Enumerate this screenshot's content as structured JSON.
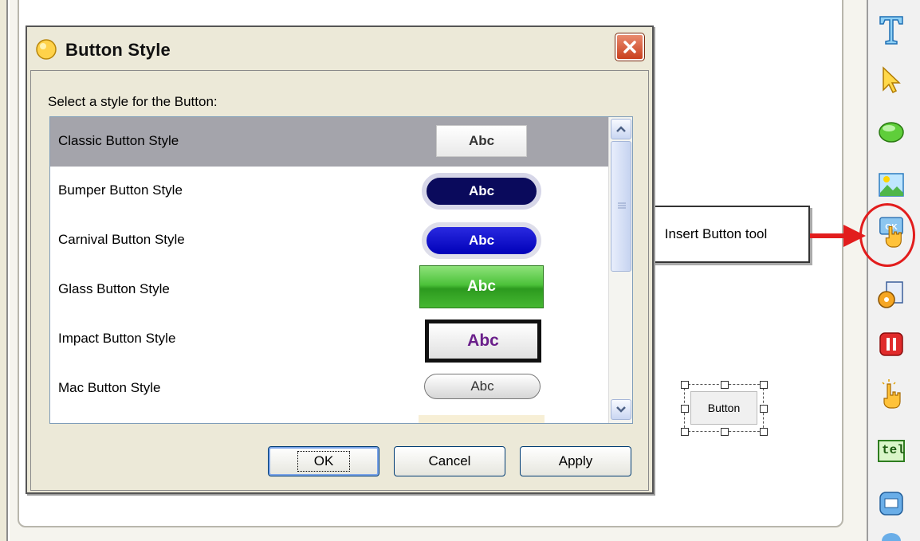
{
  "dialog": {
    "title": "Button Style",
    "prompt": "Select a style for the Button:",
    "styles": [
      {
        "label": "Classic Button Style",
        "sample": "Abc"
      },
      {
        "label": "Bumper Button Style",
        "sample": "Abc"
      },
      {
        "label": "Carnival Button Style",
        "sample": "Abc"
      },
      {
        "label": "Glass Button Style",
        "sample": "Abc"
      },
      {
        "label": "Impact Button Style",
        "sample": "Abc"
      },
      {
        "label": "Mac Button Style",
        "sample": "Abc"
      }
    ],
    "selected": "Classic Button Style",
    "buttons": {
      "ok": "OK",
      "cancel": "Cancel",
      "apply": "Apply"
    }
  },
  "callout": {
    "text": "Insert Button tool"
  },
  "canvas": {
    "placed_button": "Button"
  },
  "toolbar": {
    "tools": [
      "text-tool-icon",
      "pointer-tool-icon",
      "shape-tool-icon",
      "image-tool-icon",
      "insert-button-tool-icon",
      "media-tool-icon",
      "pause-tool-icon",
      "click-tool-icon",
      "tel-tool-icon",
      "widget-tool-icon"
    ],
    "tel_label": "tel"
  },
  "colors": {
    "highlight_ring": "#e21d1d",
    "selected_row": "#a4a4ab",
    "dialog_bg": "#ece9d8"
  }
}
